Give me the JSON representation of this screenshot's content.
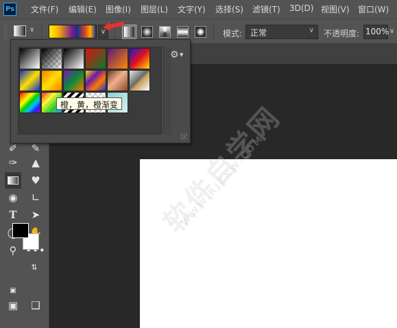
{
  "app": {
    "logo_text": "Ps"
  },
  "menu": [
    "文件(F)",
    "编辑(E)",
    "图像(I)",
    "图层(L)",
    "文字(Y)",
    "选择(S)",
    "滤镜(T)",
    "3D(D)",
    "视图(V)",
    "窗口(W)"
  ],
  "options_bar": {
    "mode_label": "模式:",
    "mode_value": "正常",
    "opacity_label": "不透明度:",
    "opacity_value": "100%"
  },
  "gradient_picker": {
    "tooltip": "橙，黄，橙渐变",
    "presets": [
      "黑，白渐变",
      "前景色到透明渐变",
      "前景色到背景色渐变",
      "红，绿渐变",
      "紫，橙渐变",
      "蓝，红，黄渐变",
      "蓝，黄，蓝渐变",
      "橙，黄，橙渐变",
      "紫，绿，橙渐变",
      "黄，紫，橙，蓝渐变",
      "铜色渐变",
      "铬黄渐变",
      "色谱",
      "透明彩虹渐变",
      "透明条纹渐变",
      "中灰密度"
    ]
  },
  "watermark": {
    "main": "软件自学网",
    "sub": "WWW.RJZXW.COM"
  },
  "colors": {
    "foreground": "#000000",
    "background": "#ffffff",
    "accent_arrow": "#e8322e"
  }
}
